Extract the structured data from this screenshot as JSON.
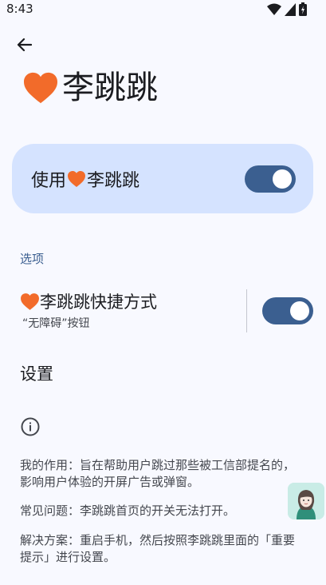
{
  "status_bar": {
    "time": "8:43"
  },
  "header": {
    "title": "李跳跳"
  },
  "main_toggle": {
    "label_prefix": "使用",
    "label_app": "李跳跳",
    "enabled": true
  },
  "options_section": {
    "header": "选项"
  },
  "shortcut": {
    "title": "李跳跳快捷方式",
    "subtitle": "“无障碍”按钮",
    "enabled": true
  },
  "settings": {
    "label": "设置"
  },
  "info": {
    "purpose": "我的作用：旨在帮助用户跳过那些被工信部提名的，影响用户体验的开屏广告或弹窗。",
    "faq": "常见问题：李跳跳首页的开关无法打开。",
    "solution": "解决方案：重启手机，然后按照李跳跳里面的「重要提示」进行设置。"
  },
  "colors": {
    "accent": "#3b5f90",
    "card": "#d5e3ff",
    "heart": "#f26b2a",
    "background": "#f8f9ff"
  },
  "icons": [
    "wifi-icon",
    "signal-icon",
    "battery-icon",
    "back-arrow-icon",
    "heart-icon",
    "info-icon",
    "avatar-icon"
  ]
}
